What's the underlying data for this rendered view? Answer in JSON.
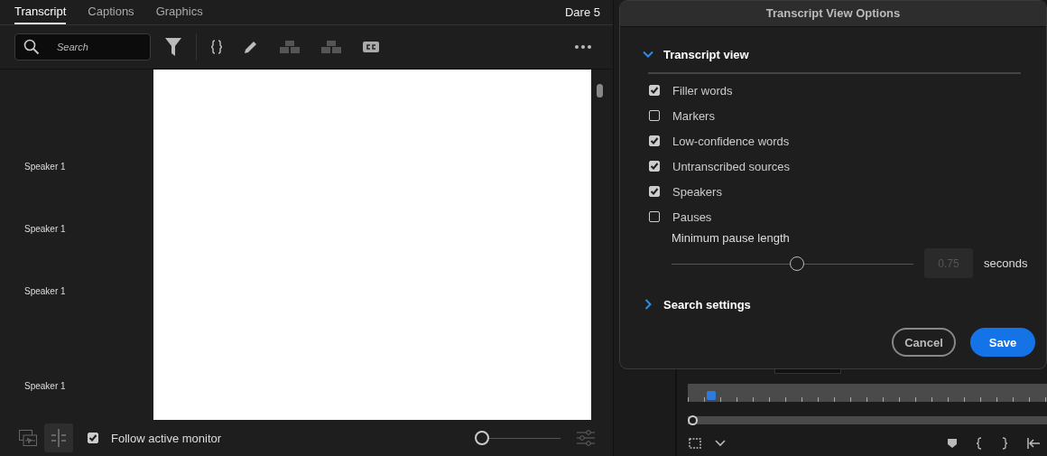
{
  "tabs": [
    {
      "label": "Transcript",
      "selected": true
    },
    {
      "label": "Captions",
      "selected": false
    },
    {
      "label": "Graphics",
      "selected": false
    }
  ],
  "sequence_name": "Dare 5",
  "search": {
    "placeholder": "Search"
  },
  "speakers": [
    "Speaker 1",
    "Speaker 1",
    "Speaker 1",
    "Speaker 1"
  ],
  "follow_active_monitor": {
    "label": "Follow active monitor",
    "checked": true
  },
  "zoom_slider": {
    "level": 0.05
  },
  "dialog": {
    "title": "Transcript View Options",
    "sections": [
      {
        "title": "Transcript view",
        "expanded": true,
        "options": [
          {
            "label": "Filler words",
            "checked": true
          },
          {
            "label": "Markers",
            "checked": false
          },
          {
            "label": "Low-confidence words",
            "checked": true
          },
          {
            "label": "Untranscribed sources",
            "checked": true
          },
          {
            "label": "Speakers",
            "checked": true
          },
          {
            "label": "Pauses",
            "checked": false
          }
        ],
        "min_pause": {
          "label": "Minimum pause length",
          "level": 0.52,
          "value": "0.75",
          "unit": "seconds",
          "disabled": true
        }
      },
      {
        "title": "Search settings",
        "expanded": false
      }
    ],
    "buttons": [
      {
        "label": "Cancel",
        "kind": "secondary"
      },
      {
        "label": "Save",
        "kind": "primary"
      }
    ]
  }
}
